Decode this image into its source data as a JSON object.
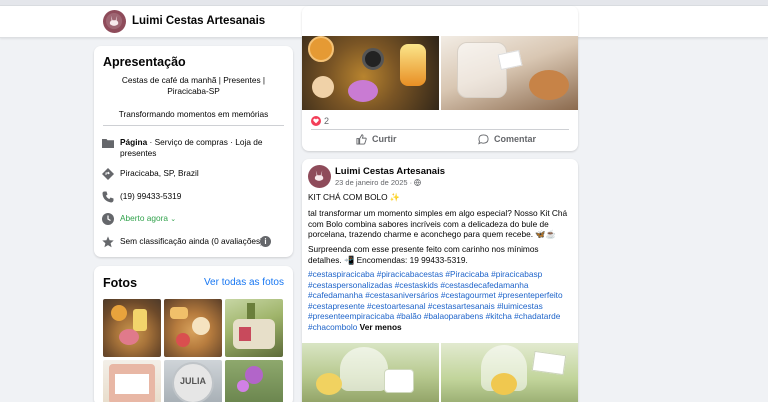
{
  "page": {
    "name": "Luimi Cestas Artesanais",
    "more_label": "···"
  },
  "intro": {
    "title": "Apresentação",
    "bio": "Cestas de café da manhã | Presentes | Piracicaba-SP",
    "tagline": "Transformando momentos em memórias",
    "category_bold": "Página",
    "category_rest": " · Serviço de compras · Loja de presentes",
    "location": "Piracicaba, SP, Brazil",
    "phone": "(19) 99433-5319",
    "hours": "Aberto agora",
    "rating": "Sem classificação ainda (0 avaliações)",
    "rating_info": "i"
  },
  "photos": {
    "title": "Fotos",
    "see_all": "Ver todas as fotos",
    "thumb_text": "JULIA"
  },
  "post1": {
    "reaction_count": "2",
    "like_label": "Curtir",
    "comment_label": "Comentar"
  },
  "post2": {
    "author": "Luimi Cestas Artesanais",
    "date": "23 de janeiro de 2025 ·",
    "line1": "KIT CHÁ COM BOLO ✨",
    "para1": " tal transformar um momento simples em algo especial? Nosso Kit Chá com Bolo combina sabores incríveis com a delicadeza do bule de porcelana, trazendo charme e aconchego para quem recebe. 🦋☕",
    "para2": "Surpreenda com esse presente feito com carinho nos mínimos detalhes. 📲 Encomendas: 19 99433-5319.",
    "hashtags": "#cestaspiracicaba #piracicabacestas #Piracicaba #piracicabasp #cestaspersonalizadas #cestaskids #cestasdecafedamanha #cafedamanha #cestasaniversários #cestagourmet #presenteperfeito #cestapresente #cestoartesanal #cestasartesanais #luimicestas #presenteempiracicaba #balão #balaoparabens #kitcha #chadatarde #chacombolo",
    "see_less": "Ver menos"
  },
  "colors": {
    "brand": "#8e4b5a",
    "link": "#1877f2",
    "hashtag": "#1d63c9",
    "open": "#31a24c",
    "heart": "#f33e58"
  }
}
